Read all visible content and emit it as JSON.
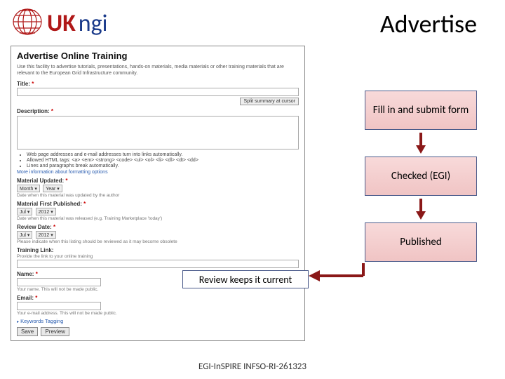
{
  "header": {
    "logo_uk": "UK",
    "logo_ngi": "ngi",
    "title": "Advertise"
  },
  "form": {
    "heading": "Advertise Online Training",
    "description": "Use this facility to advertise tutorials, presentations, hands-on materials, media materials or other training materials that are relevant to the European Grid Infrastructure community.",
    "title_label": "Title:",
    "split_btn": "Split summary at cursor",
    "desc_label": "Description:",
    "bullets": [
      "Web page addresses and e-mail addresses turn into links automatically.",
      "Allowed HTML tags: <a> <em> <strong> <code> <ul> <ol> <li> <dl> <dt> <dd>",
      "Lines and paragraphs break automatically."
    ],
    "more_info_link": "More information about formatting options",
    "mat_updated_label": "Material Updated:",
    "month_sel": "Month",
    "year_sel": "Year",
    "mat_updated_hint": "Date when this material was updated by the author",
    "mat_first_label": "Material First Published:",
    "jul_sel": "Jul",
    "y2012_sel": "2012",
    "mat_first_hint": "Date when this material was released (e.g. Training Marketplace 'today')",
    "review_label": "Review Date:",
    "review_hint": "Please indicate when this listing should be reviewed as it may become obsolete",
    "training_link_label": "Training Link:",
    "training_link_hint": "Provide the link to your online training",
    "name_label": "Name:",
    "name_hint": "Your name. This will not be made public.",
    "email_label": "Email:",
    "email_hint": "Your e-mail address. This will not be made public.",
    "keywords_tagging": "Keywords Tagging",
    "save_btn": "Save",
    "preview_btn": "Preview"
  },
  "flow": {
    "box1": "Fill in and submit form",
    "box2": "Checked (EGI)",
    "box3": "Published",
    "review_box": "Review keeps it current"
  },
  "footer": {
    "text": "EGI-InSPIRE INFSO-RI-261323"
  }
}
